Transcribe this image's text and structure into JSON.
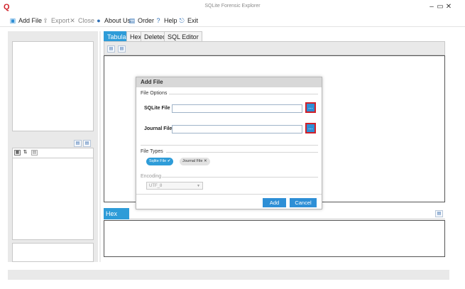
{
  "window": {
    "title": "SQLite Forensic Explorer",
    "app_icon": "Q",
    "controls": {
      "minimize": "–",
      "restore": "▭",
      "close": "✕"
    }
  },
  "toolbar": {
    "add_file": "Add File",
    "export": "Export",
    "close": "Close",
    "about": "About Us",
    "order": "Order",
    "help": "Help",
    "exit": "Exit"
  },
  "tabs": {
    "tabular": "Tabular",
    "hex": "Hex",
    "deleted": "Deleted",
    "sql_editor": "SQL Editor"
  },
  "bottom_panel": {
    "tab": "Hex"
  },
  "dialog": {
    "title": "Add File",
    "file_options_label": "File Options",
    "sqlite_file_label": "SQLite File",
    "sqlite_file_value": "",
    "journal_file_label": "Journal File",
    "journal_file_value": "",
    "browse_label": "...",
    "file_types_label": "File Types",
    "file_types": [
      {
        "label": "Sqlite File",
        "selected": true
      },
      {
        "label": "Journal File",
        "selected": false
      }
    ],
    "encoding_label": "Encoding",
    "encoding_value": "UTF_8",
    "add_button": "Add",
    "cancel_button": "Cancel"
  },
  "colors": {
    "accent": "#2e9cd8",
    "highlight": "#d0202a"
  }
}
